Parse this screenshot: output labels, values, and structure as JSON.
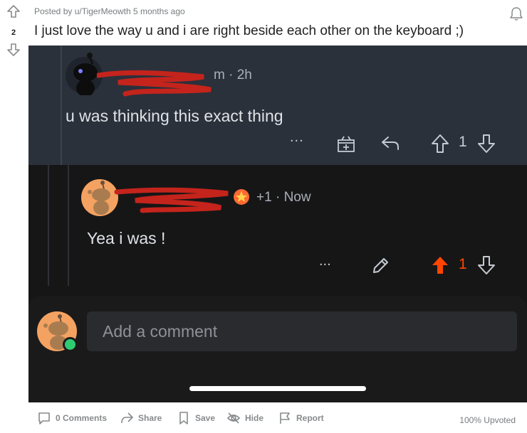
{
  "post": {
    "score": "2",
    "meta": "Posted by u/TigerMeowth 5 months ago",
    "title": "I just love the way u and i are right beside each other on the keyboard ;)"
  },
  "screenshot": {
    "comment1": {
      "username_visible": "m",
      "time": "2h",
      "text": "u was thinking this exact thing",
      "more": "...",
      "votes": "1"
    },
    "comment2": {
      "flair": "+1",
      "time": "Now",
      "text": "Yea i was !",
      "more": "...",
      "votes": "1"
    },
    "compose": {
      "placeholder": "Add a comment"
    }
  },
  "footer": {
    "comments": "0 Comments",
    "share": "Share",
    "save": "Save",
    "hide": "Hide",
    "report": "Report",
    "upvoted": "100% Upvoted"
  },
  "colors": {
    "upvote_active": "#ff4500",
    "snoo_orange": "#f4a261",
    "online": "#2ecc71"
  }
}
